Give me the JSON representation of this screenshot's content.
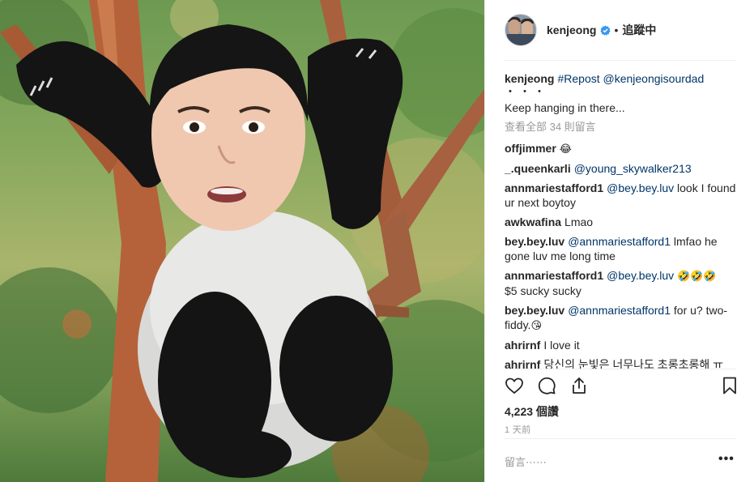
{
  "post": {
    "username": "kenjeong",
    "follow_label": "追蹤中",
    "dot": "•",
    "caption_mentions": "#Repost @kenjeongisourdad",
    "caption_dots": "・・・",
    "caption_text": "Keep hanging in there...",
    "view_all": "查看全部 34 則留言",
    "likes": "4,223 個讚",
    "time": "1 天前",
    "add_comment_placeholder": "留言⋯⋯",
    "more": "•••"
  },
  "comments": [
    {
      "user": "offjimmer",
      "mention": "",
      "text": "",
      "emoji": "😂"
    },
    {
      "user": "_.queenkarli",
      "mention": "@young_skywalker213",
      "text": "",
      "emoji": ""
    },
    {
      "user": "annmariestafford1",
      "mention": "@bey.bey.luv",
      "text": "look I found ur next boytoy",
      "emoji": ""
    },
    {
      "user": "awkwafina",
      "mention": "",
      "text": "Lmao",
      "emoji": ""
    },
    {
      "user": "bey.bey.luv",
      "mention": "@annmariestafford1",
      "text": "lmfao he gone luv me long time",
      "emoji": ""
    },
    {
      "user": "annmariestafford1",
      "mention": "@bey.bey.luv",
      "text": "$5 sucky sucky",
      "emoji": "🤣🤣🤣"
    },
    {
      "user": "bey.bey.luv",
      "mention": "@annmariestafford1",
      "text": "for u? two-fiddy.",
      "emoji": "😘"
    },
    {
      "user": "ahrirnf",
      "mention": "",
      "text": "I love it",
      "emoji": ""
    },
    {
      "user": "ahrirnf",
      "mention": "",
      "text": "당신의 눈빛은 너무나도 초롱초롱해 ㅠ",
      "emoji": ""
    }
  ],
  "colors": {
    "verified": "#3897f0",
    "link": "#003569",
    "muted": "#999999"
  },
  "icons": [
    "verified-badge-icon",
    "heart-icon",
    "comment-icon",
    "share-icon",
    "bookmark-icon"
  ]
}
